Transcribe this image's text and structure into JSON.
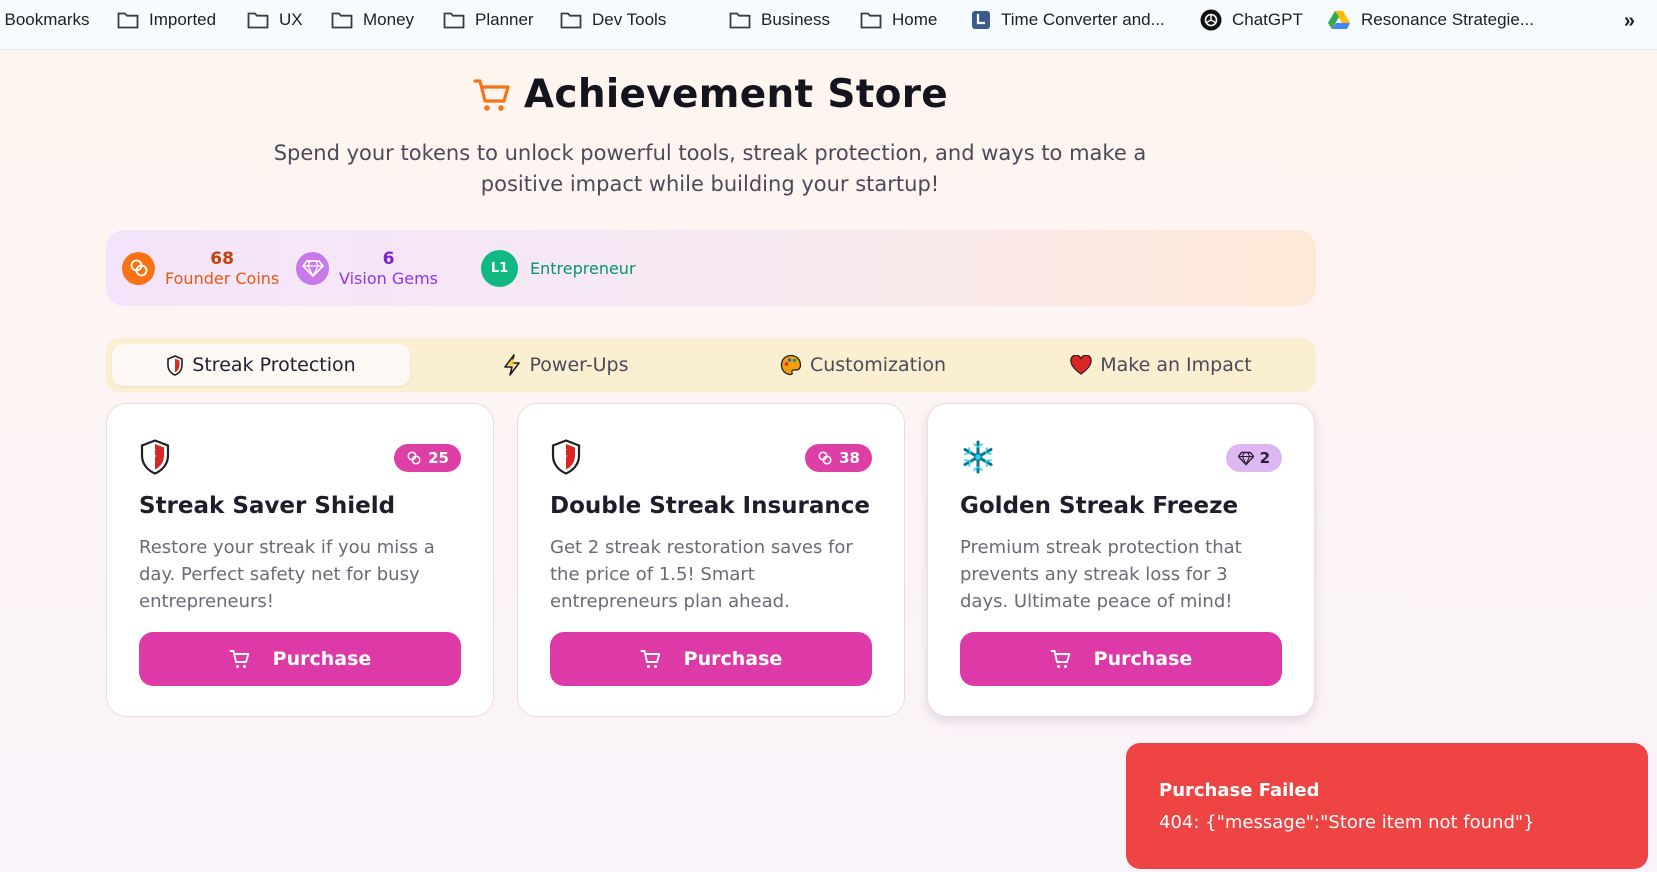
{
  "bookmarks": {
    "items": [
      {
        "label": "l Bookmarks",
        "icon": "folder-icon"
      },
      {
        "label": "Imported",
        "icon": "folder-icon"
      },
      {
        "label": "UX",
        "icon": "folder-icon"
      },
      {
        "label": "Money",
        "icon": "folder-icon"
      },
      {
        "label": "Planner",
        "icon": "folder-icon"
      },
      {
        "label": "Dev Tools",
        "icon": "folder-icon"
      },
      {
        "label": "Business",
        "icon": "folder-icon"
      },
      {
        "label": "Home",
        "icon": "folder-icon"
      },
      {
        "label": "Time Converter and...",
        "icon": "time-converter-icon"
      },
      {
        "label": "ChatGPT",
        "icon": "chatgpt-icon"
      },
      {
        "label": "Resonance Strategie...",
        "icon": "google-drive-icon"
      }
    ],
    "more_label": "»"
  },
  "header": {
    "title": "Achievement Store",
    "title_icon": "shopping-cart-icon",
    "subtitle_line1": "Spend your tokens to unlock powerful tools, streak protection, and ways to make a",
    "subtitle_line2": "positive impact while building your startup!"
  },
  "stats": {
    "coins": {
      "value": "68",
      "label": "Founder Coins",
      "icon": "coins-icon",
      "color": "#c2410c"
    },
    "gems": {
      "value": "6",
      "label": "Vision Gems",
      "icon": "gem-icon",
      "color": "#7e22ce"
    },
    "level": {
      "badge": "L1",
      "label": "Entrepreneur",
      "color": "#059669"
    }
  },
  "tabs": [
    {
      "label": "Streak Protection",
      "icon": "shield-icon",
      "active": true
    },
    {
      "label": "Power-Ups",
      "icon": "lightning-icon",
      "active": false
    },
    {
      "label": "Customization",
      "icon": "palette-icon",
      "active": false
    },
    {
      "label": "Make an Impact",
      "icon": "heart-icon",
      "active": false
    }
  ],
  "cards": [
    {
      "icon": "shield-icon",
      "price": "25",
      "currency": "coins",
      "title": "Streak Saver Shield",
      "description": "Restore your streak if you miss a day. Perfect safety net for busy entrepreneurs!",
      "button_label": "Purchase"
    },
    {
      "icon": "shield-icon",
      "price": "38",
      "currency": "coins",
      "title": "Double Streak Insurance",
      "description": "Get 2 streak restoration saves for the price of 1.5! Smart entrepreneurs plan ahead.",
      "button_label": "Purchase"
    },
    {
      "icon": "snowflake-icon",
      "price": "2",
      "currency": "gems",
      "title": "Golden Streak Freeze",
      "description": "Premium streak protection that prevents any streak loss for 3 days. Ultimate peace of mind!",
      "button_label": "Purchase"
    }
  ],
  "toast": {
    "title": "Purchase Failed",
    "message": "404: {\"message\":\"Store item not found\"}"
  },
  "colors": {
    "accent": "#dd3aa7",
    "error": "#ef4444",
    "tab_bar": "#fbefd2"
  }
}
